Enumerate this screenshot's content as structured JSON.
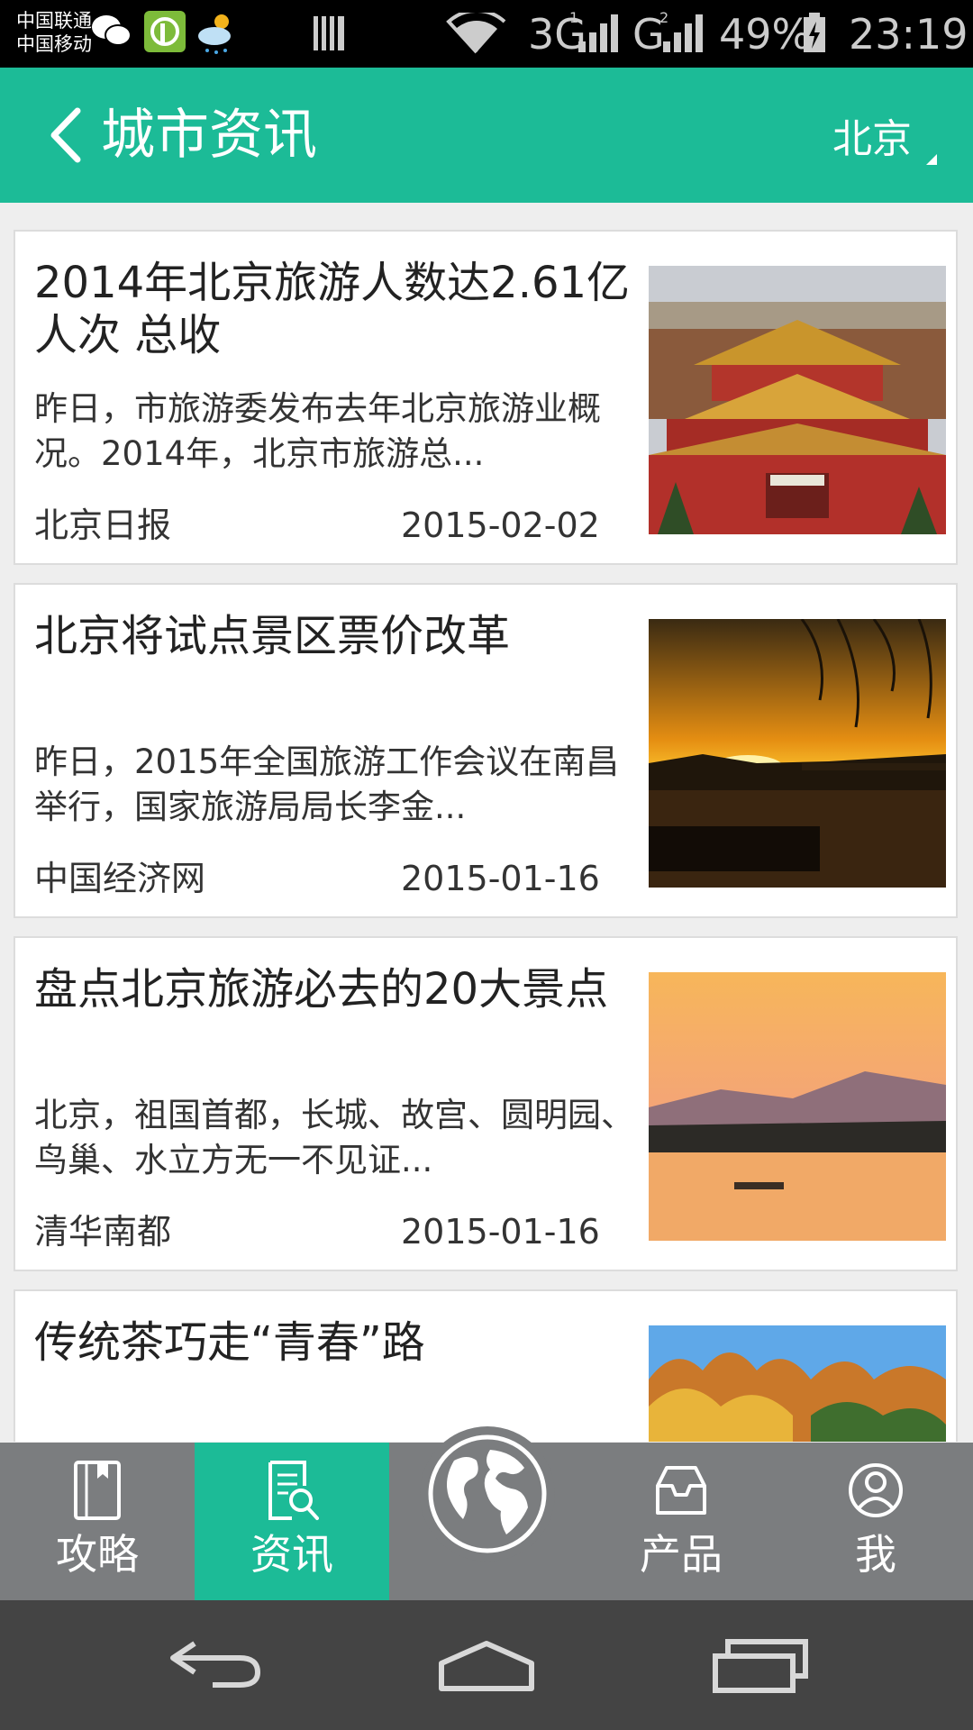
{
  "status_bar": {
    "carrier_1": "中国联通",
    "carrier_2": "中国移动",
    "network_1": "3G",
    "network_2": "G",
    "sim_1": "1",
    "sim_2": "2",
    "battery": "49%",
    "time": "23:19"
  },
  "header": {
    "title": "城市资讯",
    "city": "北京"
  },
  "news": [
    {
      "title": "2014年北京旅游人数达2.61亿人次 总收",
      "summary": "昨日，市旅游委发布去年北京旅游业概况。2014年，北京市旅游总...",
      "source": "北京日报",
      "date": "2015-02-02"
    },
    {
      "title": "北京将试点景区票价改革",
      "summary": "昨日，2015年全国旅游工作会议在南昌举行，国家旅游局局长李金...",
      "source": "中国经济网",
      "date": "2015-01-16"
    },
    {
      "title": "盘点北京旅游必去的20大景点",
      "summary": " 北京，祖国首都，长城、故宫、圆明园、鸟巢、水立方无一不见证...",
      "source": "清华南都",
      "date": "2015-01-16"
    },
    {
      "title": "传统茶巧走“青春”路",
      "summary": "",
      "source": "",
      "date": ""
    }
  ],
  "tabs": [
    {
      "label": "攻略",
      "icon": "book-icon"
    },
    {
      "label": "资讯",
      "icon": "news-search-icon"
    },
    {
      "label": "",
      "icon": "globe-icon"
    },
    {
      "label": "产品",
      "icon": "inbox-icon"
    },
    {
      "label": "我",
      "icon": "user-icon"
    }
  ],
  "active_tab": "资讯",
  "colors": {
    "accent": "#1cbb97",
    "tab_bar": "#7b7d7f",
    "nav_bar": "#444444"
  }
}
